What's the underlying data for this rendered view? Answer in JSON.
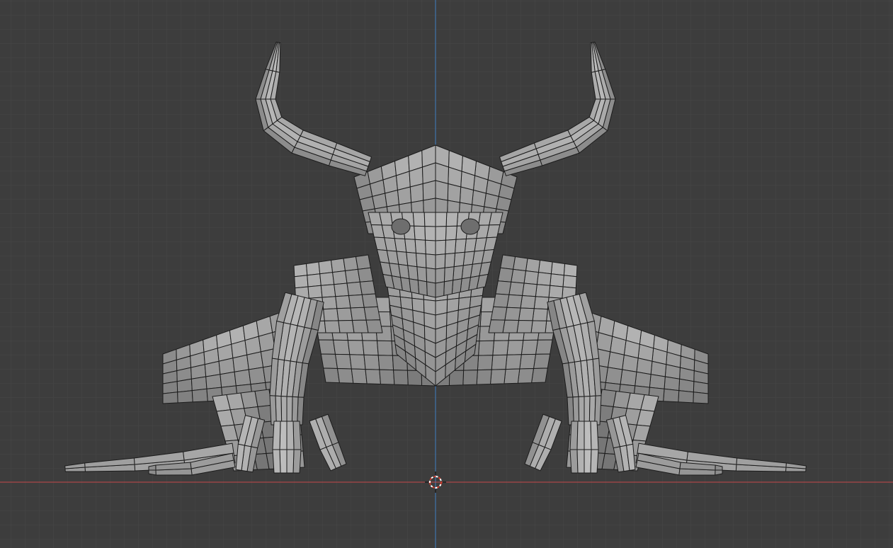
{
  "viewport": {
    "background_color": "#3d3d3d",
    "grid_minor_color": "#444444",
    "grid_major_color": "#4b4b4b",
    "x_axis_color": "#c5494a",
    "z_axis_color": "#3f7fc2",
    "mesh_fill_color": "#9a9a9a",
    "mesh_light_color": "#c4c4c4",
    "mesh_dark_color": "#5a5a5a",
    "wire_color": "#1c1c1c",
    "cursor_color": "#d23a2a"
  },
  "scene": {
    "object_icon": "sculpted-creature-mesh",
    "cursor_icon": "3d-cursor-icon",
    "mode": "mesh-edit-wireframe-overlay"
  }
}
